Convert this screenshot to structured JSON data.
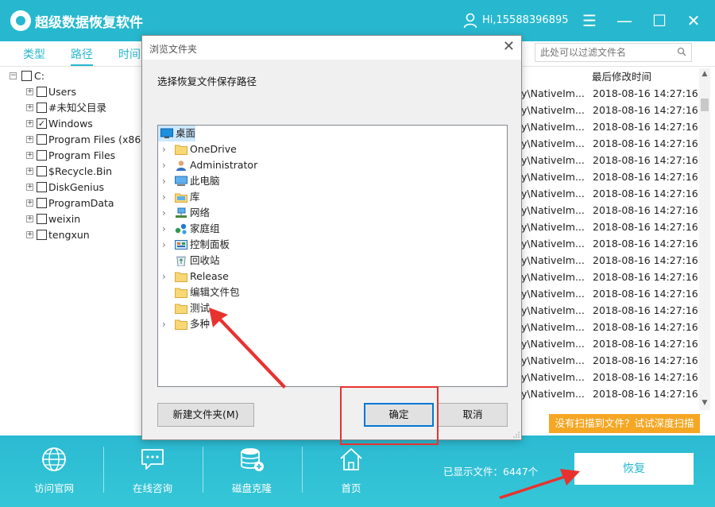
{
  "app": {
    "title": "超级数据恢复软件",
    "user": "Hi,15588396895"
  },
  "window_controls": {
    "menu": "☰",
    "minimize": "—",
    "maximize": "☐",
    "close": "✕"
  },
  "tabs": [
    {
      "label": "类型"
    },
    {
      "label": "路径"
    },
    {
      "label": "时间"
    }
  ],
  "filter": {
    "placeholder": "此处可以过滤文件名"
  },
  "tree": {
    "root": "C:",
    "items": [
      {
        "label": "Users",
        "checked": false
      },
      {
        "label": "#未知父目录",
        "checked": false
      },
      {
        "label": "Windows",
        "checked": true
      },
      {
        "label": "Program Files (x86)",
        "checked": false
      },
      {
        "label": "Program Files",
        "checked": false
      },
      {
        "label": "$Recycle.Bin",
        "checked": false
      },
      {
        "label": "DiskGenius",
        "checked": false
      },
      {
        "label": "ProgramData",
        "checked": false
      },
      {
        "label": "weixin",
        "checked": false
      },
      {
        "label": "tengxun",
        "checked": false
      }
    ]
  },
  "file_list": {
    "time_header": "最后修改时间",
    "rows": [
      {
        "path": "y\\NativeIm...",
        "time": "2018-08-16 14:27:16"
      },
      {
        "path": "y\\NativeIm...",
        "time": "2018-08-16 14:27:16"
      },
      {
        "path": "y\\NativeIm...",
        "time": "2018-08-16 14:27:16"
      },
      {
        "path": "y\\NativeIm...",
        "time": "2018-08-16 14:27:16"
      },
      {
        "path": "y\\NativeIm...",
        "time": "2018-08-16 14:27:16"
      },
      {
        "path": "y\\NativeIm...",
        "time": "2018-08-16 14:27:16"
      },
      {
        "path": "y\\NativeIm...",
        "time": "2018-08-16 14:27:16"
      },
      {
        "path": "y\\NativeIm...",
        "time": "2018-08-16 14:27:16"
      },
      {
        "path": "y\\NativeIm...",
        "time": "2018-08-16 14:27:16"
      },
      {
        "path": "y\\NativeIm...",
        "time": "2018-08-16 14:27:16"
      },
      {
        "path": "y\\NativeIm...",
        "time": "2018-08-16 14:27:16"
      },
      {
        "path": "y\\NativeIm...",
        "time": "2018-08-16 14:27:16"
      },
      {
        "path": "y\\NativeIm...",
        "time": "2018-08-16 14:27:16"
      },
      {
        "path": "y\\NativeIm...",
        "time": "2018-08-16 14:27:16"
      },
      {
        "path": "y\\NativeIm...",
        "time": "2018-08-16 14:27:16"
      },
      {
        "path": "y\\NativeIm...",
        "time": "2018-08-16 14:27:16"
      },
      {
        "path": "y\\NativeIm...",
        "time": "2018-08-16 14:27:16"
      },
      {
        "path": "y\\NativeIm...",
        "time": "2018-08-16 14:27:16"
      },
      {
        "path": "y\\NativeIm...",
        "time": "2018-08-16 14:27:16"
      }
    ]
  },
  "deep_scan": "没有扫描到文件？试试深度扫描",
  "bottom": {
    "nav": [
      {
        "label": "访问官网",
        "icon": "globe-icon"
      },
      {
        "label": "在线咨询",
        "icon": "chat-icon"
      },
      {
        "label": "磁盘克隆",
        "icon": "disk-clone-icon"
      },
      {
        "label": "首页",
        "icon": "home-icon"
      }
    ],
    "shown_files": "已显示文件：6447个",
    "recover": "恢复"
  },
  "dialog": {
    "title": "浏览文件夹",
    "prompt": "选择恢复文件保存路径",
    "close": "✕",
    "folders": [
      {
        "label": "桌面",
        "icon": "desktop-icon",
        "level": 0,
        "expandable": false,
        "selected": true
      },
      {
        "label": "OneDrive",
        "icon": "folder-icon",
        "level": 1,
        "expandable": true,
        "selected": false
      },
      {
        "label": "Administrator",
        "icon": "user-folder-icon",
        "level": 1,
        "expandable": true,
        "selected": false
      },
      {
        "label": "此电脑",
        "icon": "computer-icon",
        "level": 1,
        "expandable": true,
        "selected": false
      },
      {
        "label": "库",
        "icon": "library-icon",
        "level": 1,
        "expandable": true,
        "selected": false
      },
      {
        "label": "网络",
        "icon": "network-icon",
        "level": 1,
        "expandable": true,
        "selected": false
      },
      {
        "label": "家庭组",
        "icon": "homegroup-icon",
        "level": 1,
        "expandable": true,
        "selected": false
      },
      {
        "label": "控制面板",
        "icon": "control-panel-icon",
        "level": 1,
        "expandable": true,
        "selected": false
      },
      {
        "label": "回收站",
        "icon": "recycle-bin-icon",
        "level": 1,
        "expandable": false,
        "selected": false
      },
      {
        "label": "Release",
        "icon": "folder-icon",
        "level": 1,
        "expandable": true,
        "selected": false
      },
      {
        "label": "编辑文件包",
        "icon": "folder-icon",
        "level": 1,
        "expandable": false,
        "selected": false
      },
      {
        "label": "测试",
        "icon": "folder-icon",
        "level": 1,
        "expandable": false,
        "selected": false
      },
      {
        "label": "多种",
        "icon": "folder-icon",
        "level": 1,
        "expandable": true,
        "selected": false
      }
    ],
    "new_folder": "新建文件夹(M)",
    "ok": "确定",
    "cancel": "取消"
  },
  "colors": {
    "accent": "#27b8cf",
    "annotation": "#e8322f",
    "deep_scan": "#f5a623"
  }
}
